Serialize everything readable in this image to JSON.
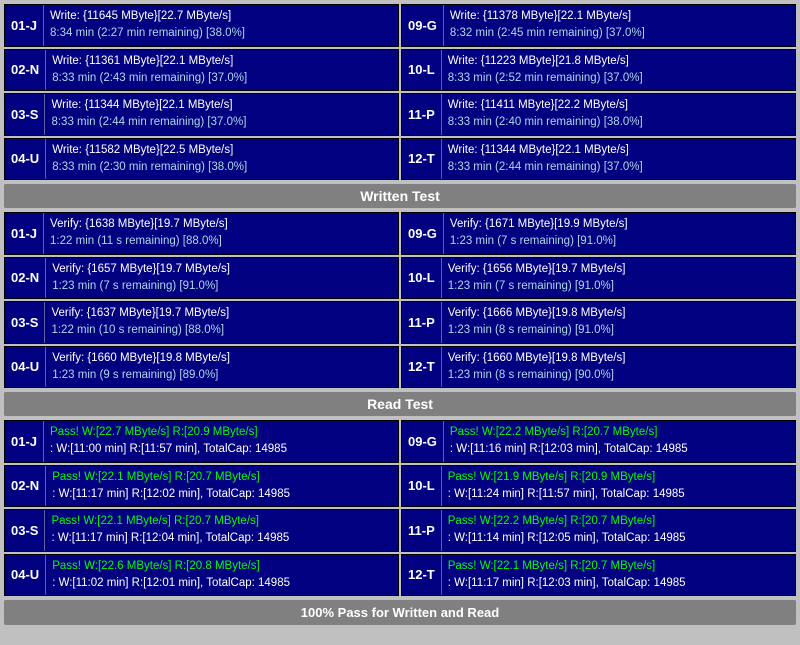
{
  "sections": {
    "write_header": "Written Test",
    "read_header": "Read Test",
    "footer": "100% Pass for Written and Read"
  },
  "write_rows": [
    {
      "left": {
        "label": "01-J",
        "line1": "Write: {11645 MByte}[22.7 MByte/s]",
        "line2": "8:34 min (2:27 min remaining)  [38.0%]"
      },
      "right": {
        "label": "09-G",
        "line1": "Write: {11378 MByte}[22.1 MByte/s]",
        "line2": "8:32 min (2:45 min remaining)  [37.0%]"
      }
    },
    {
      "left": {
        "label": "02-N",
        "line1": "Write: {11361 MByte}[22.1 MByte/s]",
        "line2": "8:33 min (2:43 min remaining)  [37.0%]"
      },
      "right": {
        "label": "10-L",
        "line1": "Write: {11223 MByte}[21.8 MByte/s]",
        "line2": "8:33 min (2:52 min remaining)  [37.0%]"
      }
    },
    {
      "left": {
        "label": "03-S",
        "line1": "Write: {11344 MByte}[22.1 MByte/s]",
        "line2": "8:33 min (2:44 min remaining)  [37.0%]"
      },
      "right": {
        "label": "11-P",
        "line1": "Write: {11411 MByte}[22.2 MByte/s]",
        "line2": "8:33 min (2:40 min remaining)  [38.0%]"
      }
    },
    {
      "left": {
        "label": "04-U",
        "line1": "Write: {11582 MByte}[22.5 MByte/s]",
        "line2": "8:33 min (2:30 min remaining)  [38.0%]"
      },
      "right": {
        "label": "12-T",
        "line1": "Write: {11344 MByte}[22.1 MByte/s]",
        "line2": "8:33 min (2:44 min remaining)  [37.0%]"
      }
    }
  ],
  "verify_rows": [
    {
      "left": {
        "label": "01-J",
        "line1": "Verify: {1638 MByte}[19.7 MByte/s]",
        "line2": "1:22 min (11 s remaining)   [88.0%]"
      },
      "right": {
        "label": "09-G",
        "line1": "Verify: {1671 MByte}[19.9 MByte/s]",
        "line2": "1:23 min (7 s remaining)   [91.0%]"
      }
    },
    {
      "left": {
        "label": "02-N",
        "line1": "Verify: {1657 MByte}[19.7 MByte/s]",
        "line2": "1:23 min (7 s remaining)   [91.0%]"
      },
      "right": {
        "label": "10-L",
        "line1": "Verify: {1656 MByte}[19.7 MByte/s]",
        "line2": "1:23 min (7 s remaining)   [91.0%]"
      }
    },
    {
      "left": {
        "label": "03-S",
        "line1": "Verify: {1637 MByte}[19.7 MByte/s]",
        "line2": "1:22 min (10 s remaining)   [88.0%]"
      },
      "right": {
        "label": "11-P",
        "line1": "Verify: {1666 MByte}[19.8 MByte/s]",
        "line2": "1:23 min (8 s remaining)   [91.0%]"
      }
    },
    {
      "left": {
        "label": "04-U",
        "line1": "Verify: {1660 MByte}[19.8 MByte/s]",
        "line2": "1:23 min (9 s remaining)   [89.0%]"
      },
      "right": {
        "label": "12-T",
        "line1": "Verify: {1660 MByte}[19.8 MByte/s]",
        "line2": "1:23 min (8 s remaining)   [90.0%]"
      }
    }
  ],
  "pass_rows": [
    {
      "left": {
        "label": "01-J",
        "line1": "Pass! W:[22.7 MByte/s] R:[20.9 MByte/s]",
        "line2": ": W:[11:00 min] R:[11:57 min], TotalCap: 14985"
      },
      "right": {
        "label": "09-G",
        "line1": "Pass! W:[22.2 MByte/s] R:[20.7 MByte/s]",
        "line2": ": W:[11:16 min] R:[12:03 min], TotalCap: 14985"
      }
    },
    {
      "left": {
        "label": "02-N",
        "line1": "Pass! W:[22.1 MByte/s] R:[20.7 MByte/s]",
        "line2": ": W:[11:17 min] R:[12:02 min], TotalCap: 14985"
      },
      "right": {
        "label": "10-L",
        "line1": "Pass! W:[21.9 MByte/s] R:[20.9 MByte/s]",
        "line2": ": W:[11:24 min] R:[11:57 min], TotalCap: 14985"
      }
    },
    {
      "left": {
        "label": "03-S",
        "line1": "Pass! W:[22.1 MByte/s] R:[20.7 MByte/s]",
        "line2": ": W:[11:17 min] R:[12:04 min], TotalCap: 14985"
      },
      "right": {
        "label": "11-P",
        "line1": "Pass! W:[22.2 MByte/s] R:[20.7 MByte/s]",
        "line2": ": W:[11:14 min] R:[12:05 min], TotalCap: 14985"
      }
    },
    {
      "left": {
        "label": "04-U",
        "line1": "Pass! W:[22.6 MByte/s] R:[20.8 MByte/s]",
        "line2": ": W:[11:02 min] R:[12:01 min], TotalCap: 14985"
      },
      "right": {
        "label": "12-T",
        "line1": "Pass! W:[22.1 MByte/s] R:[20.7 MByte/s]",
        "line2": ": W:[11:17 min] R:[12:03 min], TotalCap: 14985"
      }
    }
  ]
}
